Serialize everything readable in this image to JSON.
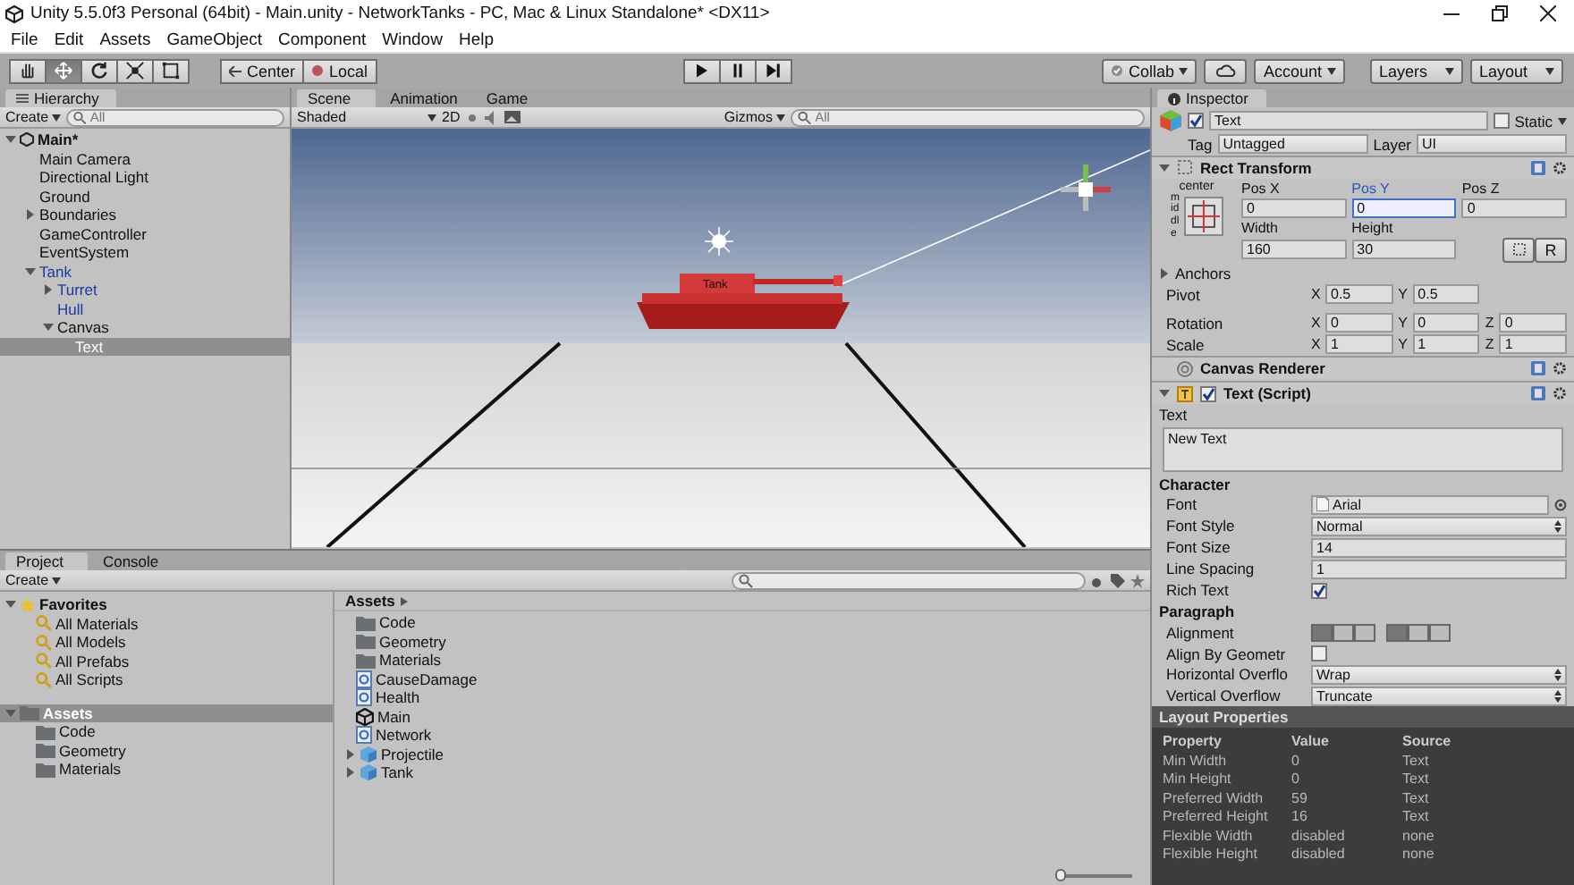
{
  "window": {
    "title": "Unity 5.5.0f3 Personal (64bit) - Main.unity - NetworkTanks - PC, Mac & Linux Standalone* <DX11>"
  },
  "menu": [
    "File",
    "Edit",
    "Assets",
    "GameObject",
    "Component",
    "Window",
    "Help"
  ],
  "toolbar": {
    "tools": [
      {
        "kind": "hand",
        "selected": false
      },
      {
        "kind": "move",
        "selected": true
      },
      {
        "kind": "rotate",
        "selected": false
      },
      {
        "kind": "scale",
        "selected": false
      },
      {
        "kind": "rect",
        "selected": false
      }
    ],
    "pivot_buttons": [
      "Center",
      "Local"
    ],
    "playback": [
      {
        "kind": "play"
      },
      {
        "kind": "pause"
      },
      {
        "kind": "step"
      }
    ],
    "right_buttons": [
      {
        "kind": "dropdown",
        "label": "Collab"
      },
      {
        "kind": "cloud"
      },
      {
        "kind": "dropdown",
        "label": "Account"
      },
      {
        "kind": "dropdown",
        "label": "Layers"
      },
      {
        "kind": "dropdown",
        "label": "Layout"
      }
    ]
  },
  "hierarchy": {
    "tab": "Hierarchy",
    "create": "Create",
    "search_placeholder": "All",
    "scene": "Main*",
    "items": [
      {
        "label": "Main Camera",
        "prefab": false,
        "selected": false
      },
      {
        "label": "Directional Light",
        "prefab": false,
        "selected": false
      },
      {
        "label": "Ground",
        "prefab": false,
        "selected": false
      },
      {
        "label": "Boundaries",
        "prefab": false,
        "selected": false,
        "expanded": false
      },
      {
        "label": "GameController",
        "prefab": false,
        "selected": false
      },
      {
        "label": "EventSystem",
        "prefab": false,
        "selected": false
      },
      {
        "label": "Tank",
        "prefab": true,
        "selected": false,
        "expanded": true,
        "children": [
          {
            "label": "Turret",
            "prefab": true,
            "selected": false,
            "expanded": false
          },
          {
            "label": "Hull",
            "prefab": true,
            "selected": false
          },
          {
            "label": "Canvas",
            "prefab": false,
            "selected": false,
            "expanded": true,
            "children": [
              {
                "label": "Text",
                "prefab": false,
                "selected": true
              }
            ]
          }
        ]
      }
    ]
  },
  "scene": {
    "tabs": [
      {
        "label": "Scene",
        "selected": true
      },
      {
        "label": "Animation",
        "selected": false
      },
      {
        "label": "Game",
        "selected": false
      }
    ],
    "shading": "Shaded",
    "mode_2d": "2D",
    "gizmos": "Gizmos",
    "search_placeholder": "All",
    "tank_label": "Tank"
  },
  "inspector": {
    "tab": "Inspector",
    "object": {
      "active": true,
      "name": "Text",
      "static": false,
      "static_label": "Static",
      "tag_label": "Tag",
      "tag": "Untagged",
      "layer_label": "Layer",
      "layer": "UI"
    },
    "rect_transform": {
      "title": "Rect Transform",
      "anchor_h": "center",
      "anchor_v": "middle",
      "pos_fields": [
        {
          "label": "Pos X",
          "value": "0",
          "focused": false
        },
        {
          "label": "Pos Y",
          "value": "0",
          "focused": true
        },
        {
          "label": "Pos Z",
          "value": "0",
          "focused": false
        }
      ],
      "size_fields": [
        {
          "label": "Width",
          "value": "160"
        },
        {
          "label": "Height",
          "value": "30"
        }
      ],
      "raw_button": "R",
      "anchors": "Anchors",
      "vectors": [
        {
          "label": "Pivot",
          "fields": [
            {
              "axis": "X",
              "value": "0.5"
            },
            {
              "axis": "Y",
              "value": "0.5"
            }
          ]
        },
        {
          "label": "Rotation",
          "fields": [
            {
              "axis": "X",
              "value": "0"
            },
            {
              "axis": "Y",
              "value": "0"
            },
            {
              "axis": "Z",
              "value": "0"
            }
          ]
        },
        {
          "label": "Scale",
          "fields": [
            {
              "axis": "X",
              "value": "1"
            },
            {
              "axis": "Y",
              "value": "1"
            },
            {
              "axis": "Z",
              "value": "1"
            }
          ]
        }
      ]
    },
    "canvas_renderer": {
      "title": "Canvas Renderer"
    },
    "text_script": {
      "title": "Text (Script)",
      "enabled": true,
      "text_label": "Text",
      "text": "New Text",
      "sections": [
        {
          "title": "Character",
          "rows": [
            {
              "kind": "object",
              "label": "Font",
              "value": "Arial"
            },
            {
              "kind": "dropdown",
              "label": "Font Style",
              "value": "Normal"
            },
            {
              "kind": "field",
              "label": "Font Size",
              "value": "14"
            },
            {
              "kind": "field",
              "label": "Line Spacing",
              "value": "1"
            },
            {
              "kind": "checkbox",
              "label": "Rich Text",
              "checked": true
            }
          ]
        },
        {
          "title": "Paragraph",
          "rows": [
            {
              "kind": "alignment",
              "label": "Alignment",
              "horizontal": [
                {
                  "selected": true
                },
                {
                  "selected": false
                },
                {
                  "selected": false
                }
              ],
              "vertical": [
                {
                  "selected": true
                },
                {
                  "selected": false
                },
                {
                  "selected": false
                }
              ]
            },
            {
              "kind": "checkbox",
              "label": "Align By Geometr",
              "checked": false
            },
            {
              "kind": "dropdown",
              "label": "Horizontal Overflo",
              "value": "Wrap"
            },
            {
              "kind": "dropdown",
              "label": "Vertical Overflow",
              "value": "Truncate"
            }
          ]
        }
      ]
    },
    "layout_properties": {
      "title": "Layout Properties",
      "columns": [
        "Property",
        "Value",
        "Source"
      ],
      "rows": [
        [
          "Min Width",
          "0",
          "Text"
        ],
        [
          "Min Height",
          "0",
          "Text"
        ],
        [
          "Preferred Width",
          "59",
          "Text"
        ],
        [
          "Preferred Height",
          "16",
          "Text"
        ],
        [
          "Flexible Width",
          "disabled",
          "none"
        ],
        [
          "Flexible Height",
          "disabled",
          "none"
        ]
      ]
    }
  },
  "project": {
    "tabs": [
      {
        "label": "Project",
        "selected": true
      },
      {
        "label": "Console",
        "selected": false
      }
    ],
    "create": "Create",
    "favorites": {
      "label": "Favorites",
      "items": [
        "All Materials",
        "All Models",
        "All Prefabs",
        "All Scripts"
      ]
    },
    "assets": {
      "label": "Assets",
      "selected": true,
      "children": [
        "Code",
        "Geometry",
        "Materials"
      ]
    },
    "breadcrumb": "Assets",
    "files": [
      {
        "kind": "folder",
        "label": "Code"
      },
      {
        "kind": "folder",
        "label": "Geometry"
      },
      {
        "kind": "folder",
        "label": "Materials"
      },
      {
        "kind": "script",
        "label": "CauseDamage"
      },
      {
        "kind": "script",
        "label": "Health"
      },
      {
        "kind": "scene",
        "label": "Main"
      },
      {
        "kind": "script",
        "label": "Network"
      },
      {
        "kind": "prefab",
        "label": "Projectile"
      },
      {
        "kind": "prefab",
        "label": "Tank"
      }
    ],
    "zoom_slider": {
      "level": 0
    }
  }
}
